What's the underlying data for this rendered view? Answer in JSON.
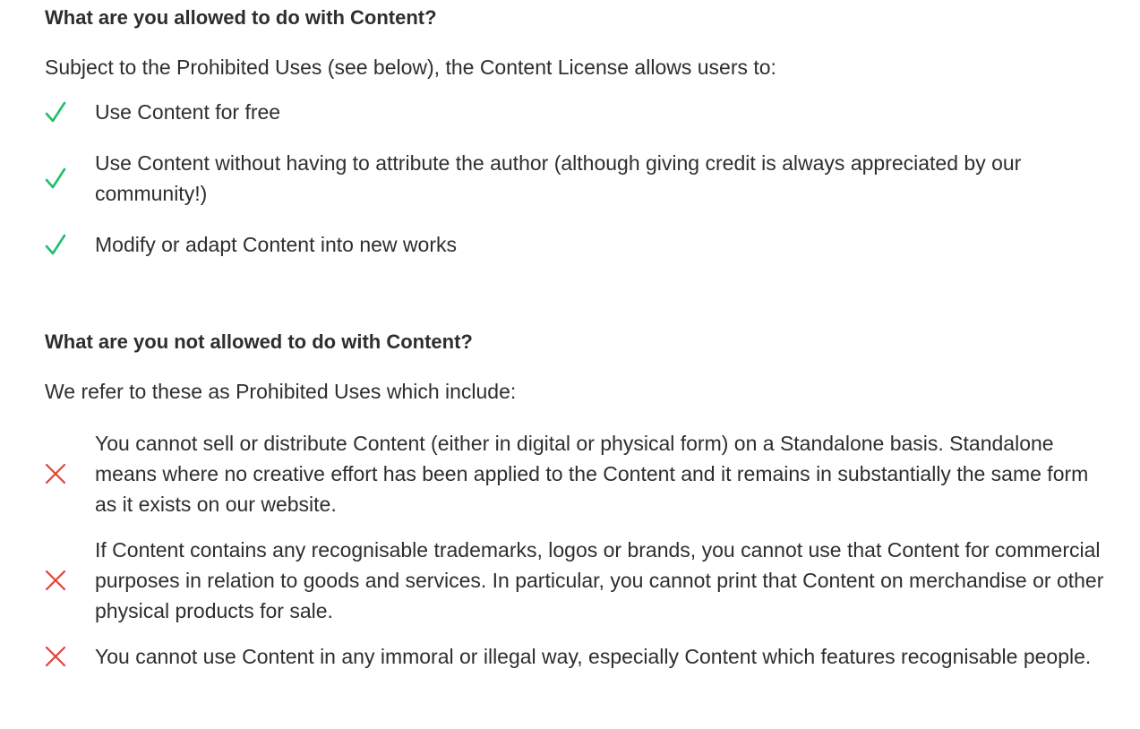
{
  "allowed": {
    "heading": "What are you allowed to do with Content?",
    "intro": "Subject to the Prohibited Uses (see below), the Content License allows users to:",
    "items": [
      {
        "icon": "check-icon",
        "text": "Use Content for free"
      },
      {
        "icon": "check-icon",
        "text": "Use Content without having to attribute the author (although giving credit is always appreciated by our community!)"
      },
      {
        "icon": "check-icon",
        "text": "Modify or adapt Content into new works"
      }
    ]
  },
  "not_allowed": {
    "heading": "What are you not allowed to do with Content?",
    "intro": "We refer to these as Prohibited Uses which include:",
    "items": [
      {
        "icon": "cross-icon",
        "text": "You cannot sell or distribute Content (either in digital or physical form) on a Standalone basis. Standalone means where no creative effort has been applied to the Content and it remains in substantially the same form as it exists on our website."
      },
      {
        "icon": "cross-icon",
        "text": "If Content contains any recognisable trademarks, logos or brands, you cannot use that Content for commercial purposes in relation to goods and services. In particular, you cannot print that Content on merchandise or other physical products for sale."
      },
      {
        "icon": "cross-icon",
        "text": "You cannot use Content in any immoral or illegal way, especially Content which features recognisable people."
      }
    ]
  },
  "colors": {
    "check": "#1fbf6b",
    "cross": "#e0433a",
    "text": "#2e2e2e"
  }
}
